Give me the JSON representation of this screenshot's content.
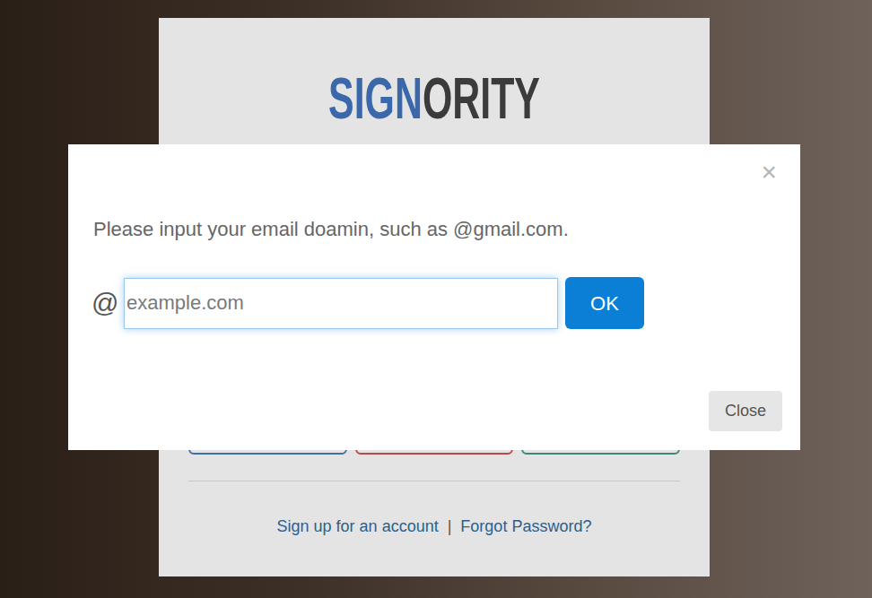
{
  "login": {
    "logo": {
      "part1": "SIGN",
      "part2": "ORITY"
    },
    "social_buttons": [
      {
        "color": "#3f6fa6"
      },
      {
        "color": "#b9494a"
      },
      {
        "color": "#3f857d"
      }
    ],
    "links": [
      "Sign up for an account",
      "Forgot Password?"
    ],
    "separator": "|"
  },
  "modal": {
    "close_icon": "×",
    "message": "Please input your email doamin, such as @gmail.com.",
    "prefix": "@",
    "input": {
      "placeholder": "example.com",
      "focused": true
    },
    "ok_button": "OK",
    "close_button": "Close"
  }
}
